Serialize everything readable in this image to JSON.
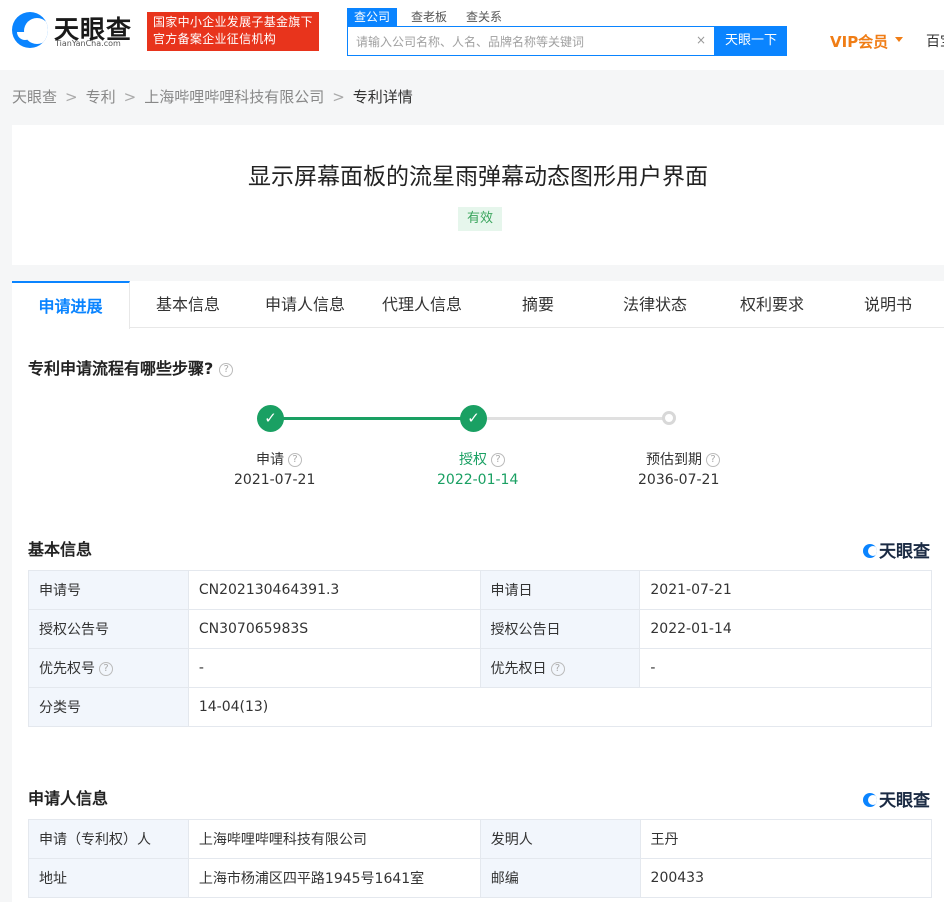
{
  "header": {
    "logo_cn": "天眼查",
    "logo_en": "TianYanCha.com",
    "badge_line1": "国家中小企业发展子基金旗下",
    "badge_line2": "官方备案企业征信机构",
    "search_tabs": [
      "查公司",
      "查老板",
      "查关系"
    ],
    "search_placeholder": "请输入公司名称、人名、品牌名称等关键词",
    "clear_symbol": "×",
    "search_button": "天眼一下",
    "vip_label": "VIP会员",
    "more_nav": "百宝箱"
  },
  "breadcrumb": [
    "天眼查",
    "专利",
    "上海哔哩哔哩科技有限公司",
    "专利详情"
  ],
  "breadcrumb_sep": ">",
  "patent": {
    "title": "显示屏幕面板的流星雨弹幕动态图形用户界面",
    "status": "有效"
  },
  "tabs": [
    "申请进展",
    "基本信息",
    "申请人信息",
    "代理人信息",
    "摘要",
    "法律状态",
    "权利要求",
    "说明书"
  ],
  "progress": {
    "question": "专利申请流程有哪些步骤?",
    "help_symbol": "?",
    "check_symbol": "✓",
    "steps": [
      {
        "label": "申请",
        "date": "2021-07-21",
        "state": "done"
      },
      {
        "label": "授权",
        "date": "2022-01-14",
        "state": "done"
      },
      {
        "label": "预估到期",
        "date": "2036-07-21",
        "state": "pending"
      }
    ]
  },
  "watermark": "天眼查",
  "basic_info": {
    "title": "基本信息",
    "rows": [
      {
        "k1": "申请号",
        "v1": "CN202130464391.3",
        "k2": "申请日",
        "v2": "2021-07-21"
      },
      {
        "k1": "授权公告号",
        "v1": "CN307065983S",
        "k2": "授权公告日",
        "v2": "2022-01-14"
      },
      {
        "k1": "优先权号",
        "v1": "-",
        "k2": "优先权日",
        "v2": "-"
      },
      {
        "k1": "分类号",
        "v1": "14-04(13)"
      }
    ]
  },
  "applicant_info": {
    "title": "申请人信息",
    "rows": [
      {
        "k1": "申请（专利权）人",
        "v1": "上海哔哩哔哩科技有限公司",
        "k2": "发明人",
        "v2": "王丹"
      },
      {
        "k1": "地址",
        "v1": "上海市杨浦区四平路1945号1641室",
        "k2": "邮编",
        "v2": "200433"
      }
    ]
  }
}
